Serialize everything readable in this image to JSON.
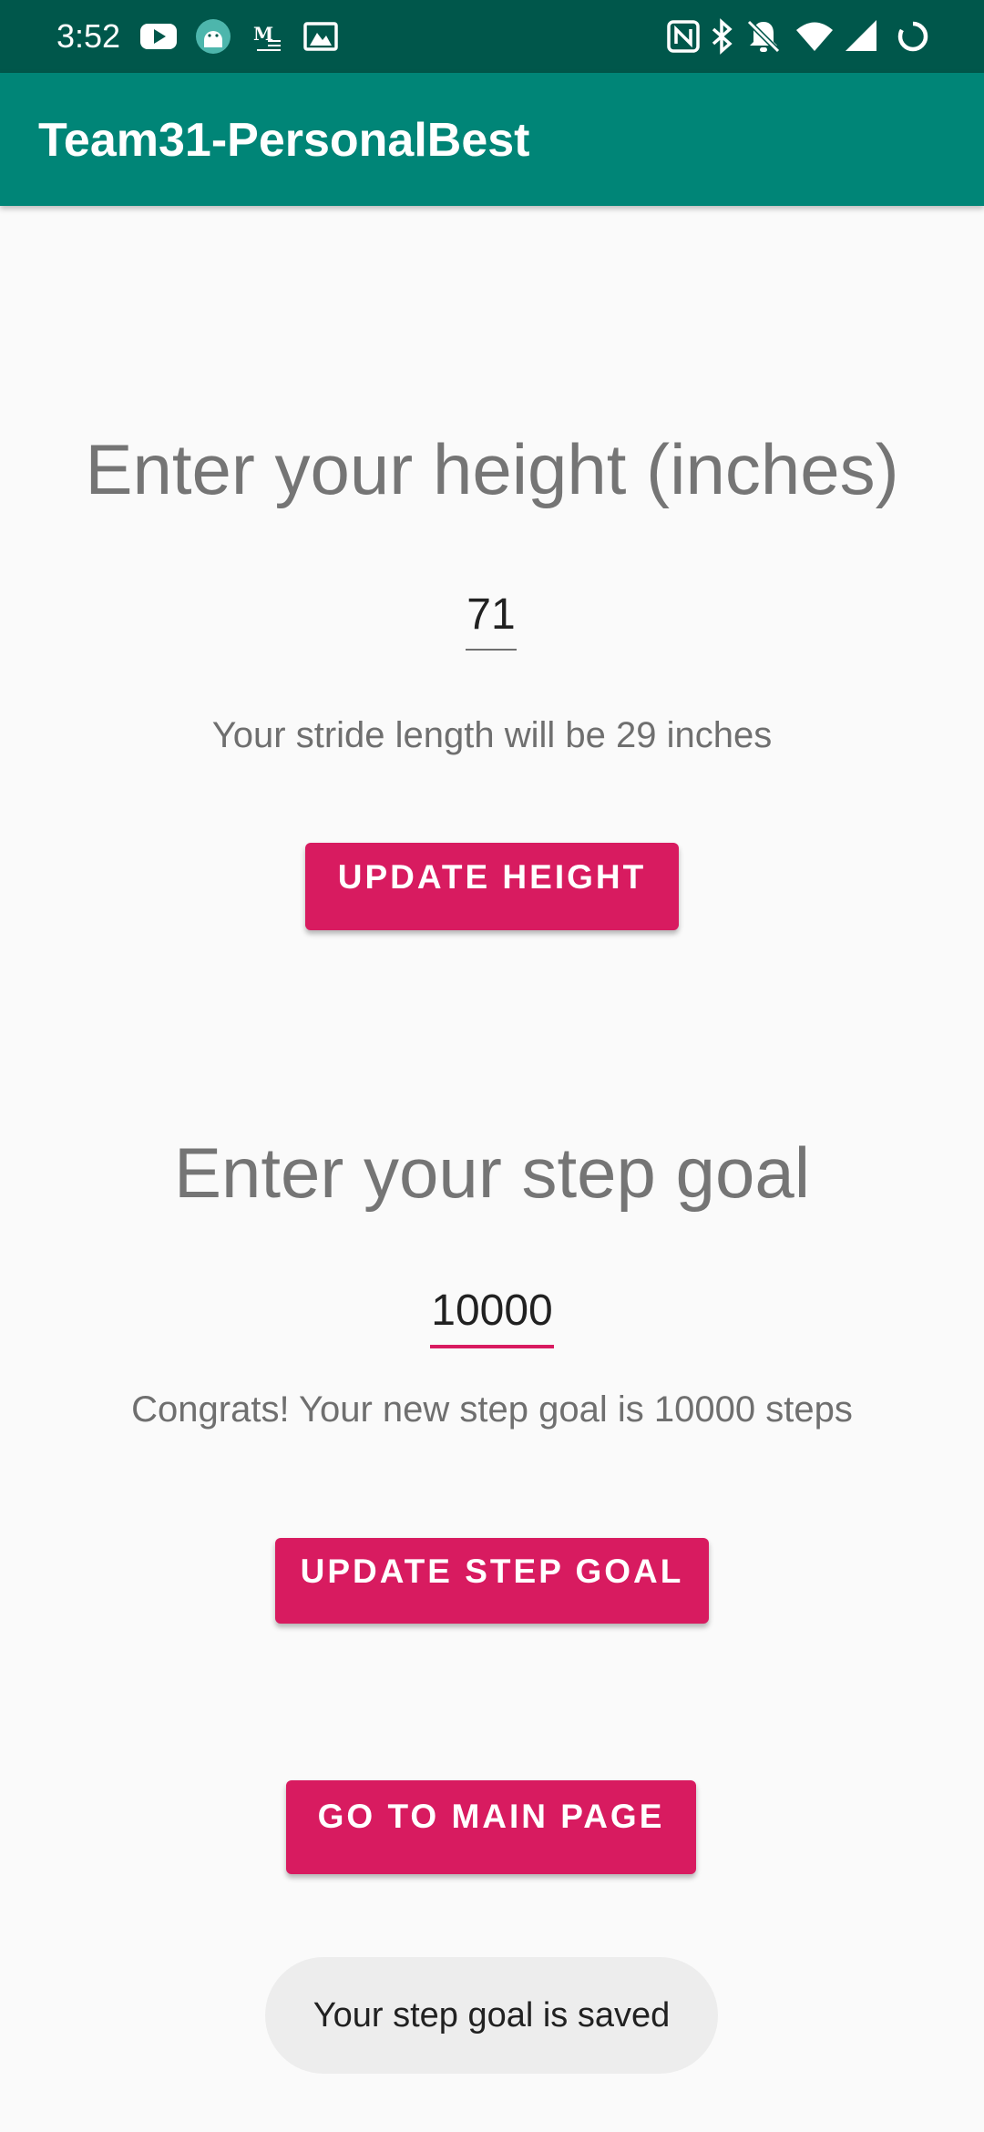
{
  "status_bar": {
    "time": "3:52",
    "left_icons": [
      "youtube-icon",
      "android-icon",
      "gmail-m-icon",
      "gallery-icon"
    ],
    "right_icons": [
      "nfc-icon",
      "bluetooth-icon",
      "notifications-off-icon",
      "wifi-icon",
      "signal-icon",
      "battery-icon"
    ]
  },
  "app_bar": {
    "title": "Team31-PersonalBest"
  },
  "height_section": {
    "heading": "Enter your height (inches)",
    "value": "71",
    "helper": "Your stride length will be 29 inches",
    "button_label": "UPDATE HEIGHT"
  },
  "step_goal_section": {
    "heading": "Enter your step goal",
    "value": "10000",
    "helper": "Congrats! Your new step goal is 10000 steps",
    "button_label": "UPDATE STEP GOAL"
  },
  "main_page_button": {
    "label": "GO TO MAIN PAGE"
  },
  "toast": {
    "message": "Your step goal is saved"
  },
  "colors": {
    "status_bar": "#00574b",
    "app_bar": "#008577",
    "accent": "#d81b60"
  }
}
